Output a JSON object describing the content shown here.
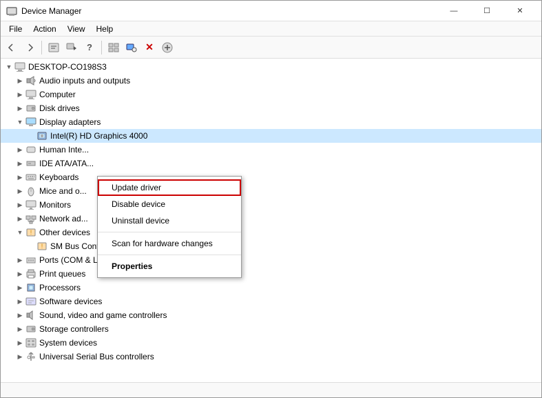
{
  "window": {
    "title": "Device Manager",
    "controls": {
      "minimize": "—",
      "maximize": "☐",
      "close": "✕"
    }
  },
  "menu": {
    "items": [
      "File",
      "Action",
      "View",
      "Help"
    ]
  },
  "toolbar": {
    "buttons": [
      "←",
      "→",
      "⊞",
      "⊟",
      "?",
      "⊡",
      "🖥",
      "🖨",
      "✕",
      "⊕"
    ]
  },
  "tree": {
    "root": "DESKTOP-CO198S3",
    "items": [
      {
        "label": "Audio inputs and outputs",
        "indent": 1,
        "expanded": false,
        "icon": "audio"
      },
      {
        "label": "Computer",
        "indent": 1,
        "expanded": false,
        "icon": "computer"
      },
      {
        "label": "Disk drives",
        "indent": 1,
        "expanded": false,
        "icon": "disk"
      },
      {
        "label": "Display adapters",
        "indent": 1,
        "expanded": true,
        "icon": "display"
      },
      {
        "label": "Intel(R) HD Graphics 4000",
        "indent": 2,
        "expanded": false,
        "icon": "chip",
        "selected": true
      },
      {
        "label": "Human Inte...",
        "indent": 1,
        "expanded": false,
        "icon": "hid"
      },
      {
        "label": "IDE ATA/ATA...",
        "indent": 1,
        "expanded": false,
        "icon": "ide"
      },
      {
        "label": "Keyboards",
        "indent": 1,
        "expanded": false,
        "icon": "keyboard"
      },
      {
        "label": "Mice and o...",
        "indent": 1,
        "expanded": false,
        "icon": "mouse"
      },
      {
        "label": "Monitors",
        "indent": 1,
        "expanded": false,
        "icon": "monitor"
      },
      {
        "label": "Network ad...",
        "indent": 1,
        "expanded": false,
        "icon": "network"
      },
      {
        "label": "Other devices",
        "indent": 1,
        "expanded": true,
        "icon": "other"
      },
      {
        "label": "SM Bus Controller",
        "indent": 2,
        "expanded": false,
        "icon": "smbus"
      },
      {
        "label": "Ports (COM & LPT)",
        "indent": 1,
        "expanded": false,
        "icon": "ports"
      },
      {
        "label": "Print queues",
        "indent": 1,
        "expanded": false,
        "icon": "print"
      },
      {
        "label": "Processors",
        "indent": 1,
        "expanded": false,
        "icon": "cpu"
      },
      {
        "label": "Software devices",
        "indent": 1,
        "expanded": false,
        "icon": "software"
      },
      {
        "label": "Sound, video and game controllers",
        "indent": 1,
        "expanded": false,
        "icon": "sound"
      },
      {
        "label": "Storage controllers",
        "indent": 1,
        "expanded": false,
        "icon": "storage"
      },
      {
        "label": "System devices",
        "indent": 1,
        "expanded": false,
        "icon": "system"
      },
      {
        "label": "Universal Serial Bus controllers",
        "indent": 1,
        "expanded": false,
        "icon": "usb"
      }
    ]
  },
  "context_menu": {
    "items": [
      {
        "label": "Update driver",
        "highlighted": true
      },
      {
        "label": "Disable device"
      },
      {
        "label": "Uninstall device"
      },
      {
        "separator": true
      },
      {
        "label": "Scan for hardware changes"
      },
      {
        "separator": true
      },
      {
        "label": "Properties",
        "bold": true
      }
    ]
  },
  "status_bar": {
    "text": ""
  }
}
